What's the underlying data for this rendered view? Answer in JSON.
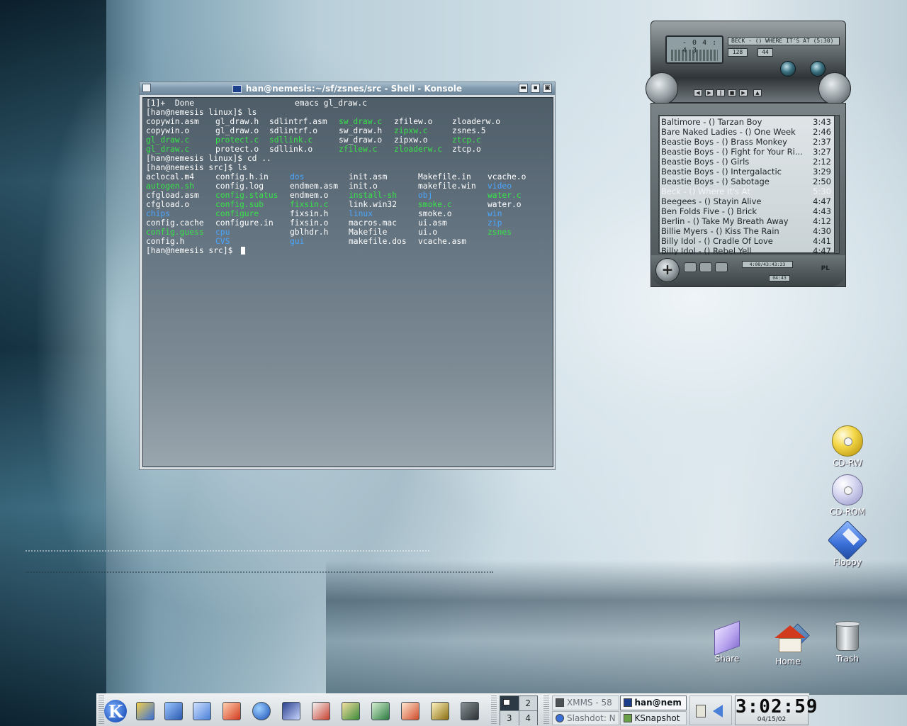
{
  "konsole": {
    "title": "han@nemesis:~/sf/zsnes/src - Shell - Konsole",
    "lines": [
      {
        "segs": [
          {
            "t": "[1]+  Done",
            "c": ""
          },
          {
            "t": "emacs gl_draw.c",
            "c": ""
          }
        ]
      },
      {
        "segs": [
          {
            "t": "[han@nemesis linux]$ ls",
            "c": ""
          }
        ]
      },
      {
        "segs": [
          {
            "t": "copywin.asm",
            "c": ""
          },
          {
            "t": "gl_draw.h",
            "c": ""
          },
          {
            "t": "sdlintrf.asm",
            "c": ""
          },
          {
            "t": "sw_draw.c",
            "c": "green"
          },
          {
            "t": "zfilew.o",
            "c": ""
          },
          {
            "t": "zloaderw.o",
            "c": ""
          }
        ]
      },
      {
        "segs": [
          {
            "t": "copywin.o",
            "c": ""
          },
          {
            "t": "gl_draw.o",
            "c": ""
          },
          {
            "t": "sdlintrf.o",
            "c": ""
          },
          {
            "t": "sw_draw.h",
            "c": ""
          },
          {
            "t": "zipxw.c",
            "c": "green"
          },
          {
            "t": "zsnes.5",
            "c": ""
          }
        ]
      },
      {
        "segs": [
          {
            "t": "gl_draw.c",
            "c": "green"
          },
          {
            "t": "protect.c",
            "c": "green"
          },
          {
            "t": "sdllink.c",
            "c": "green"
          },
          {
            "t": "sw_draw.o",
            "c": ""
          },
          {
            "t": "zipxw.o",
            "c": ""
          },
          {
            "t": "ztcp.c",
            "c": "green"
          }
        ]
      },
      {
        "segs": [
          {
            "t": "gl_draw.c",
            "c": "green"
          },
          {
            "t": "protect.o",
            "c": ""
          },
          {
            "t": "sdllink.o",
            "c": ""
          },
          {
            "t": "zfilew.c",
            "c": "green"
          },
          {
            "t": "zloaderw.c",
            "c": "green"
          },
          {
            "t": "ztcp.o",
            "c": ""
          }
        ]
      },
      {
        "segs": [
          {
            "t": "[han@nemesis linux]$ cd ..",
            "c": ""
          }
        ]
      },
      {
        "segs": [
          {
            "t": "[han@nemesis src]$ ls",
            "c": ""
          }
        ]
      },
      {
        "segs": [
          {
            "t": "aclocal.m4",
            "c": ""
          },
          {
            "t": "config.h.in",
            "c": ""
          },
          {
            "t": "dos",
            "c": "blue"
          },
          {
            "t": "init.asm",
            "c": ""
          },
          {
            "t": "Makefile.in",
            "c": ""
          },
          {
            "t": "vcache.o",
            "c": ""
          }
        ]
      },
      {
        "segs": [
          {
            "t": "autogen.sh",
            "c": "green"
          },
          {
            "t": "config.log",
            "c": ""
          },
          {
            "t": "endmem.asm",
            "c": ""
          },
          {
            "t": "init.o",
            "c": ""
          },
          {
            "t": "makefile.win",
            "c": ""
          },
          {
            "t": "video",
            "c": "blue"
          }
        ]
      },
      {
        "segs": [
          {
            "t": "cfgload.asm",
            "c": ""
          },
          {
            "t": "config.status",
            "c": "green"
          },
          {
            "t": "endmem.o",
            "c": ""
          },
          {
            "t": "install-sh",
            "c": "green"
          },
          {
            "t": "obj",
            "c": "blue"
          },
          {
            "t": "water.c",
            "c": "green"
          }
        ]
      },
      {
        "segs": [
          {
            "t": "cfgload.o",
            "c": ""
          },
          {
            "t": "config.sub",
            "c": "green"
          },
          {
            "t": "fixsin.c",
            "c": "green"
          },
          {
            "t": "link.win32",
            "c": ""
          },
          {
            "t": "smoke.c",
            "c": "green"
          },
          {
            "t": "water.o",
            "c": ""
          }
        ]
      },
      {
        "segs": [
          {
            "t": "chips",
            "c": "blue"
          },
          {
            "t": "configure",
            "c": "green"
          },
          {
            "t": "fixsin.h",
            "c": ""
          },
          {
            "t": "linux",
            "c": "blue"
          },
          {
            "t": "smoke.o",
            "c": ""
          },
          {
            "t": "win",
            "c": "blue"
          }
        ]
      },
      {
        "segs": [
          {
            "t": "config.cache",
            "c": ""
          },
          {
            "t": "configure.in",
            "c": ""
          },
          {
            "t": "fixsin.o",
            "c": ""
          },
          {
            "t": "macros.mac",
            "c": ""
          },
          {
            "t": "ui.asm",
            "c": ""
          },
          {
            "t": "zip",
            "c": "blue"
          }
        ]
      },
      {
        "segs": [
          {
            "t": "config.guess",
            "c": "green"
          },
          {
            "t": "cpu",
            "c": "blue"
          },
          {
            "t": "gblhdr.h",
            "c": ""
          },
          {
            "t": "Makefile",
            "c": ""
          },
          {
            "t": "ui.o",
            "c": ""
          },
          {
            "t": "zsnes",
            "c": "green"
          }
        ]
      },
      {
        "segs": [
          {
            "t": "config.h",
            "c": ""
          },
          {
            "t": "CVS",
            "c": "blue"
          },
          {
            "t": "gui",
            "c": "blue"
          },
          {
            "t": "makefile.dos",
            "c": ""
          },
          {
            "t": "vcache.asm",
            "c": ""
          }
        ]
      },
      {
        "segs": [
          {
            "t": "[han@nemesis src]$ ",
            "c": ""
          }
        ],
        "cursor": true
      }
    ]
  },
  "xmms": {
    "time": "- 0 4 : 4 3",
    "song": "BECK - () WHERE IT'S AT (5:30)",
    "kbps": "128",
    "khz": "44",
    "playlist": [
      {
        "title": "Baltimore - () Tarzan Boy",
        "dur": "3:43",
        "playing": false
      },
      {
        "title": "Bare Naked Ladies - () One Week",
        "dur": "2:46",
        "playing": false
      },
      {
        "title": "Beastie Boys - () Brass Monkey",
        "dur": "2:37",
        "playing": false
      },
      {
        "title": "Beastie Boys - () Fight for Your Ri...",
        "dur": "3:27",
        "playing": false
      },
      {
        "title": "Beastie Boys - () Girls",
        "dur": "2:12",
        "playing": false
      },
      {
        "title": "Beastie Boys - () Intergalactic",
        "dur": "3:29",
        "playing": false
      },
      {
        "title": "Beastie Boys - () Sabotage",
        "dur": "2:50",
        "playing": false
      },
      {
        "title": "Beck - () Where It's At",
        "dur": "5:30",
        "playing": true
      },
      {
        "title": "Beegees - () Stayin Alive",
        "dur": "4:47",
        "playing": false
      },
      {
        "title": "Ben Folds Five - () Brick",
        "dur": "4:43",
        "playing": false
      },
      {
        "title": "Berlin - () Take My Breath Away",
        "dur": "4:12",
        "playing": false
      },
      {
        "title": "Billie Myers - () Kiss The Rain",
        "dur": "4:30",
        "playing": false
      },
      {
        "title": "Billy Idol - () Cradle Of Love",
        "dur": "4:41",
        "playing": false
      },
      {
        "title": "Billy Idol - () Rebel Yell",
        "dur": "4:47",
        "playing": false
      }
    ],
    "pl_info": "4:08/43:43:23",
    "pl_time": "04:43",
    "pl_label": "PL"
  },
  "desktop_icons": {
    "cdrw": "CD-RW",
    "cdrom": "CD-ROM",
    "floppy": "Floppy",
    "share": "Share",
    "home": "Home",
    "trash": "Trash"
  },
  "panel": {
    "pager": [
      "1",
      "2",
      "3",
      "4"
    ],
    "tasks": [
      {
        "label": "XMMS - 58",
        "active": false
      },
      {
        "label": "han@nem",
        "active": true
      },
      {
        "label": "Slashdot: N",
        "active": false
      },
      {
        "label": "KSnapshot",
        "active": false
      }
    ],
    "clock_time": "3:02:59",
    "clock_date": "04/15/02"
  },
  "colors": {
    "terminal_green": "#39e24a",
    "terminal_blue": "#4aa6ff",
    "title_bar": "#7f98ab"
  }
}
